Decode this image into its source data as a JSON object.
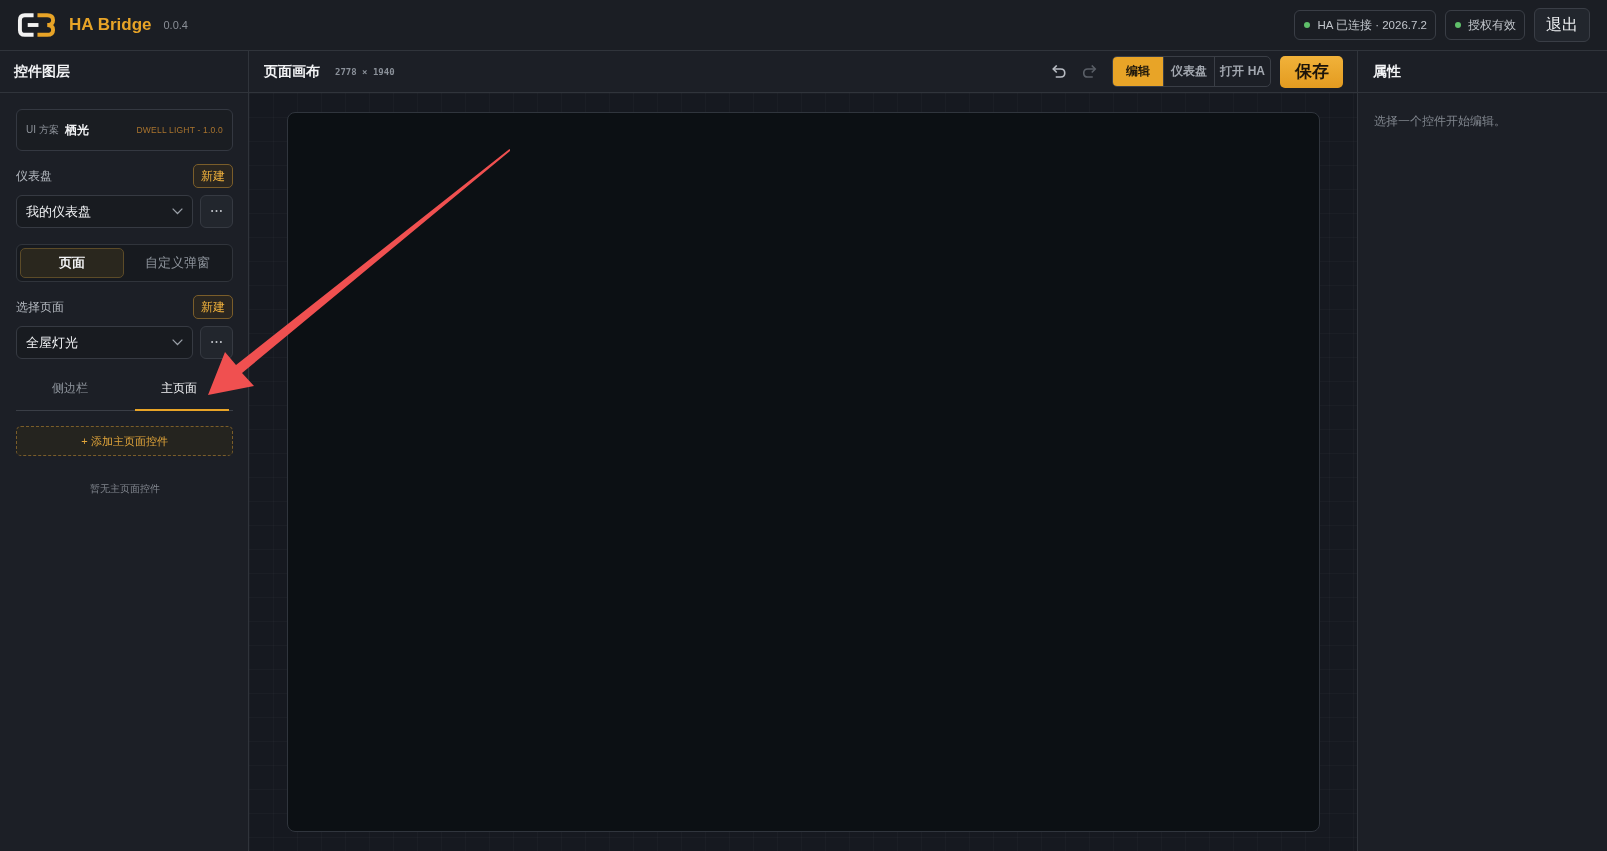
{
  "header": {
    "brand": "HA Bridge",
    "version": "0.0.4",
    "status": [
      {
        "label": "HA 已连接 · 2026.7.2",
        "ok": true
      },
      {
        "label": "授权有效",
        "ok": true
      }
    ],
    "logout_button": "退出"
  },
  "layers_panel": {
    "title": "控件图层",
    "ui_scheme": {
      "label": "UI 方案",
      "name": "栖光",
      "theme": "DWELL LIGHT - 1.0.0"
    },
    "dashboard": {
      "label": "仪表盘",
      "new_button": "新建",
      "value": "我的仪表盘"
    },
    "mode_tabs": [
      {
        "label": "页面",
        "selected": true
      },
      {
        "label": "自定义弹窗",
        "selected": false
      }
    ],
    "page": {
      "label": "选择页面",
      "new_button": "新建",
      "value": "全屋灯光"
    },
    "section_tabs": [
      {
        "label": "侧边栏",
        "selected": false
      },
      {
        "label": "主页面",
        "selected": true
      }
    ],
    "add_button": "+ 添加主页面控件",
    "empty_text": "暂无主页面控件"
  },
  "canvas": {
    "title": "页面画布",
    "size": "2778 × 1940",
    "history_buttons": [
      {
        "kind": "undo",
        "disabled": false
      },
      {
        "kind": "redo",
        "disabled": true
      }
    ],
    "view_tabs": [
      {
        "label": "编辑",
        "selected": true
      },
      {
        "label": "仪表盘",
        "selected": false
      },
      {
        "label": "打开 HA",
        "selected": false
      }
    ],
    "save_button": "保存"
  },
  "properties_panel": {
    "title": "属性",
    "hint": "选择一个控件开始编辑。"
  }
}
